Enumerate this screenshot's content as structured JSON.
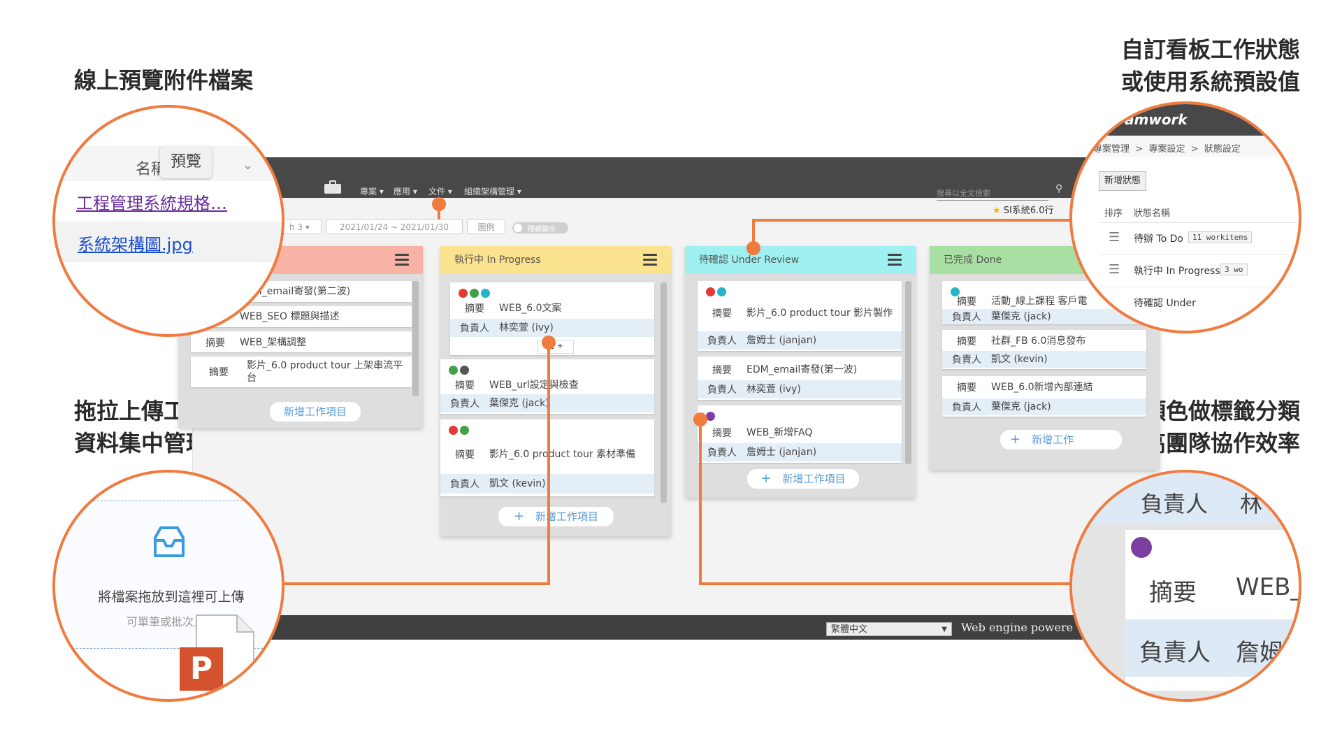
{
  "colors": {
    "accent": "#f07b3f",
    "todo": "#f8b3a6",
    "in_progress": "#fbe28f",
    "review": "#9ff0f0",
    "done": "#a8dfa2"
  },
  "features": {
    "preview_title": "線上預覽附件檔案",
    "custom_line1": "自訂看板工作狀態",
    "custom_line2": "或使用系統預設值",
    "drag_line1": "拖拉上傳工作附件",
    "drag_line2": "資料集中管理",
    "color_line1": "以顏色做標籤分類",
    "color_line2": "提高團隊協作效率"
  },
  "app": {
    "logo": "teamwork",
    "menu": [
      "專案",
      "應用",
      "文件",
      "組織架構管理"
    ],
    "search_placeholder": "搜尋以全文檢索",
    "toolbar": {
      "sprint": "h 3",
      "date_range": "2021/01/24 ~ 2021/01/30",
      "label": "圖例",
      "toggle": "隱藏顯示"
    },
    "project": "SI系統6.0行",
    "columns": [
      {
        "title": "",
        "cards": [
          {
            "rows": [
              [
                "",
                "EDM_email寄發(第二波)"
              ]
            ]
          },
          {
            "rows": [
              [
                "",
                "WEB_SEO 標題與描述"
              ]
            ]
          },
          {
            "rows": [
              [
                "摘要",
                "WEB_架構調整"
              ]
            ]
          },
          {
            "rows": [
              [
                "摘要",
                "影片_6.0 product tour 上架串流平台"
              ]
            ]
          }
        ],
        "add": "新增工作項目"
      },
      {
        "title": "執行中 In Progress",
        "cards": [
          {
            "rows": [
              [
                "摘要",
                "WEB_6.0文案"
              ],
              [
                "負責人",
                "林奕萱 (ivy)"
              ]
            ],
            "comment": "1"
          },
          {
            "rows": [
              [
                "摘要",
                "WEB_url設定與檢查"
              ],
              [
                "負責人",
                "葉傑克 (jack)"
              ]
            ]
          },
          {
            "rows": [
              [
                "摘要",
                "影片_6.0 product tour 素材準備"
              ],
              [
                "負責人",
                "凱文 (kevin)"
              ]
            ]
          }
        ],
        "add": "新增工作項目"
      },
      {
        "title": "待確認 Under Review",
        "cards": [
          {
            "rows": [
              [
                "摘要",
                "影片_6.0 product tour 影片製作"
              ],
              [
                "負責人",
                "詹姆士 (janjan)"
              ]
            ]
          },
          {
            "rows": [
              [
                "摘要",
                "EDM_email寄發(第一波)"
              ],
              [
                "負責人",
                "林奕萱 (ivy)"
              ]
            ]
          },
          {
            "rows": [
              [
                "摘要",
                "WEB_新增FAQ"
              ],
              [
                "負責人",
                "詹姆士 (janjan)"
              ]
            ]
          }
        ],
        "add": "新增工作項目"
      },
      {
        "title": "已完成 Done",
        "cards": [
          {
            "rows": [
              [
                "摘要",
                "活動_線上課程 客戶電"
              ],
              [
                "負責人",
                "葉傑克 (jack)"
              ]
            ]
          },
          {
            "rows": [
              [
                "摘要",
                "社群_FB 6.0消息發布"
              ],
              [
                "負責人",
                "凱文 (kevin)"
              ]
            ]
          },
          {
            "rows": [
              [
                "摘要",
                "WEB_6.0新增內部連結"
              ],
              [
                "負責人",
                "葉傑克 (jack)"
              ]
            ]
          }
        ],
        "add": "新增工作"
      }
    ],
    "footer": {
      "language": "繁體中文",
      "engine": "Web engine powere"
    }
  },
  "zoom_preview": {
    "header": "名稱",
    "tooltip": "預覽",
    "files": [
      "工程管理系統規格…",
      "系統架構圖.jpg"
    ]
  },
  "zoom_status": {
    "logo": "amwork",
    "breadcrumb": [
      "專案管理",
      "專案設定",
      "狀態設定"
    ],
    "add_button": "新增狀態",
    "col_order": "排序",
    "col_name": "狀態名稱",
    "rows": [
      {
        "name": "待辦 To Do",
        "count": "11 workitems"
      },
      {
        "name": "執行中 In Progress",
        "count": "3 wo"
      },
      {
        "name": "待確認 Under",
        "count": ""
      }
    ]
  },
  "zoom_upload": {
    "text": "將檔案拖放到這裡可上傳",
    "sub": "可單筆或批次上傳",
    "file_badge": "P"
  },
  "zoom_tag": {
    "k1": "負責人",
    "v1": "林",
    "k2": "摘要",
    "v2": "WEB_",
    "k3": "負責人",
    "v3": "詹姆"
  }
}
